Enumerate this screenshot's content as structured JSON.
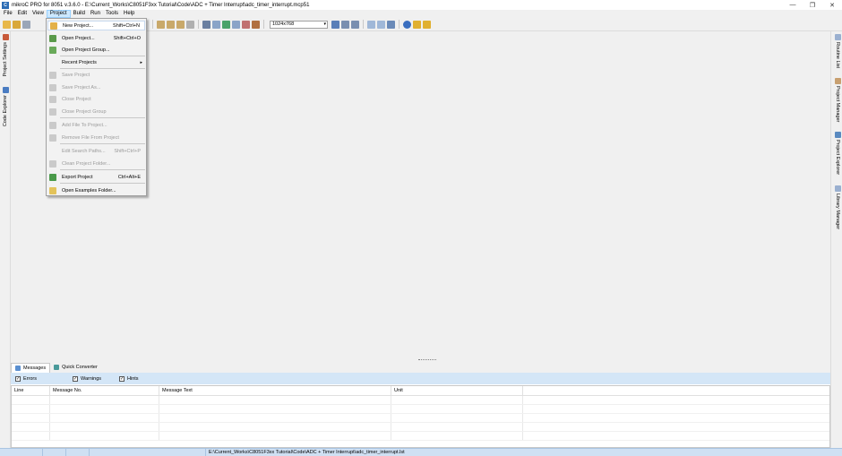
{
  "window": {
    "title": "mikroC PRO for 8051 v.3.6.0 - E:\\Current_Works\\C8051F3xx Tutorial\\Code\\ADC + Timer Interrupt\\adc_timer_interrupt.mcp51",
    "app_icon_letter": "C",
    "minimize": "—",
    "restore": "❐",
    "close": "✕"
  },
  "menubar": {
    "items": [
      "File",
      "Edit",
      "View",
      "Project",
      "Build",
      "Run",
      "Tools",
      "Help"
    ],
    "active": "Project"
  },
  "toolbar": {
    "resolution": "1024x768"
  },
  "project_menu": {
    "items": [
      {
        "label": "New Project...",
        "shortcut": "Shift+Ctrl+N",
        "enabled": true,
        "icon": "new-project-icon"
      },
      {
        "label": "Open Project...",
        "shortcut": "Shift+Ctrl+O",
        "enabled": true,
        "icon": "open-project-icon"
      },
      {
        "label": "Open Project Group...",
        "shortcut": "",
        "enabled": true,
        "icon": "open-group-icon"
      },
      {
        "label": "Recent Projects",
        "shortcut": "",
        "enabled": true,
        "icon": "",
        "submenu": "▸"
      },
      {
        "label": "Save Project",
        "shortcut": "",
        "enabled": false,
        "icon": "save-project-icon"
      },
      {
        "label": "Save Project As...",
        "shortcut": "",
        "enabled": false,
        "icon": "save-as-icon"
      },
      {
        "label": "Close Project",
        "shortcut": "",
        "enabled": false,
        "icon": "close-project-icon"
      },
      {
        "label": "Close Project Group",
        "shortcut": "",
        "enabled": false,
        "icon": "close-group-icon"
      },
      {
        "label": "Add File To Project...",
        "shortcut": "",
        "enabled": false,
        "icon": "add-file-icon"
      },
      {
        "label": "Remove File From Project",
        "shortcut": "",
        "enabled": false,
        "icon": "remove-file-icon"
      },
      {
        "label": "Edit Search Paths...",
        "shortcut": "Shift+Ctrl+P",
        "enabled": false,
        "icon": ""
      },
      {
        "label": "Clean Project Folder...",
        "shortcut": "",
        "enabled": false,
        "icon": "clean-folder-icon"
      },
      {
        "label": "Export  Project",
        "shortcut": "Ctrl+Alt+E",
        "enabled": true,
        "icon": "export-project-icon"
      },
      {
        "label": "Open Examples Folder...",
        "shortcut": "",
        "enabled": true,
        "icon": "examples-folder-icon"
      }
    ]
  },
  "left_tabs": [
    "Project Settings",
    "Code Explorer"
  ],
  "right_tabs": [
    "Routine List",
    "Project Manager",
    "Project Explorer",
    "Library Manager"
  ],
  "bottom_panel": {
    "tabs": [
      "Messages",
      "Quick Converter"
    ],
    "filters": [
      {
        "label": "Errors",
        "checked": true
      },
      {
        "label": "Warnings",
        "checked": true
      },
      {
        "label": "Hints",
        "checked": true
      }
    ],
    "columns": [
      "Line",
      "Message No.",
      "Message Text",
      "Unit"
    ]
  },
  "statusbar": {
    "path": "E:\\Current_Works\\C8051F3xx Tutorial\\Code\\ADC + Timer Interrupt\\adc_timer_interrupt.lst"
  },
  "colors": {
    "accent": "#4a7cc2",
    "status_bg": "#cfe0f3",
    "filter_bg": "#d4e6f7"
  }
}
